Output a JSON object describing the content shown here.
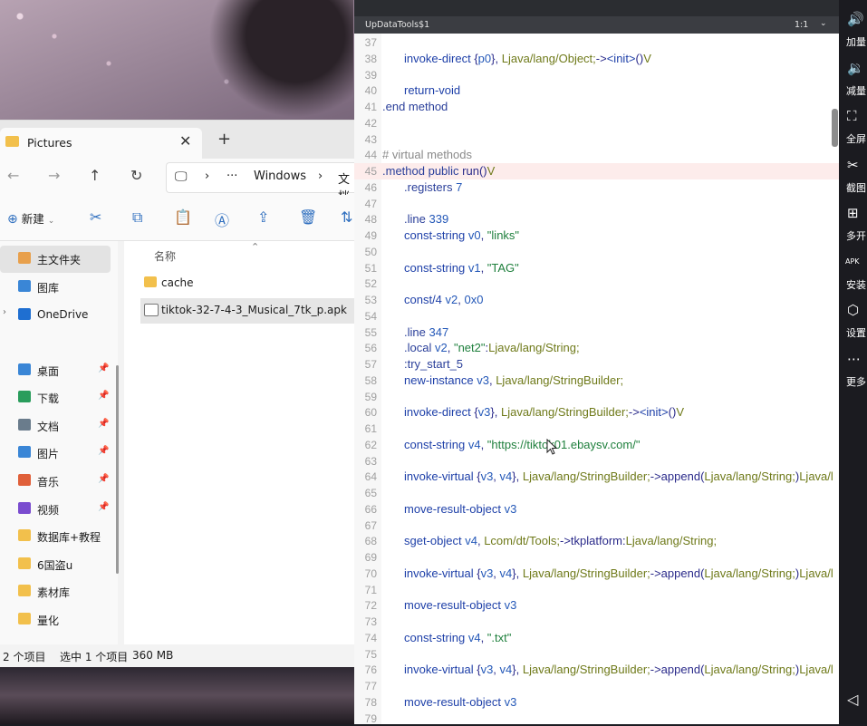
{
  "explorer": {
    "tab_title": "Pictures",
    "close_glyph": "✕",
    "new_tab_glyph": "+",
    "breadcrumb": [
      "Windows",
      "文档"
    ],
    "more_glyph": "···",
    "toolbar": {
      "new_label": "新建"
    },
    "sidebar": [
      {
        "label": "主文件夹",
        "icon": "home-icon",
        "color": "#e8a04c"
      },
      {
        "label": "图库",
        "icon": "gallery-icon",
        "color": "#3a86d6"
      },
      {
        "label": "OneDrive",
        "icon": "cloud-icon",
        "color": "#1f6fd1"
      },
      {
        "label": "桌面",
        "icon": "desktop-icon",
        "color": "#3a86d6",
        "pinned": true
      },
      {
        "label": "下载",
        "icon": "download-icon",
        "color": "#2a9d5c",
        "pinned": true
      },
      {
        "label": "文档",
        "icon": "document-icon",
        "color": "#6a7c8c",
        "pinned": true
      },
      {
        "label": "图片",
        "icon": "picture-icon",
        "color": "#3a86d6",
        "pinned": true
      },
      {
        "label": "音乐",
        "icon": "music-icon",
        "color": "#e0603a",
        "pinned": true
      },
      {
        "label": "视频",
        "icon": "video-icon",
        "color": "#7a4ccf",
        "pinned": true
      },
      {
        "label": "数据库+教程",
        "icon": "folder-icon",
        "color": "#f2c04c"
      },
      {
        "label": "6国盗u",
        "icon": "folder-icon",
        "color": "#f2c04c"
      },
      {
        "label": "素材库",
        "icon": "folder-icon",
        "color": "#f2c04c"
      },
      {
        "label": "量化",
        "icon": "folder-icon",
        "color": "#f2c04c"
      }
    ],
    "column_header": "名称",
    "files": [
      {
        "name": "cache",
        "type": "folder"
      },
      {
        "name": "tiktok-32-7-4-3_Musical_7tk_p.apk",
        "type": "apk"
      }
    ],
    "status": {
      "count": "2 个项目",
      "selected": "选中 1 个项目",
      "size": "360 MB"
    }
  },
  "editor": {
    "file_title": "UpDataTools$1",
    "cursor_pos": "1:1",
    "lines": [
      {
        "n": "37",
        "html": ""
      },
      {
        "n": "38",
        "html": "    <span class='kw'>invoke-direct</span> {<span class='reg'>p0</span>}, <span class='cls'>Ljava/lang/Object;</span>-><span class='kw'>&lt;init&gt;</span>()<span class='cls'>V</span>"
      },
      {
        "n": "39",
        "html": ""
      },
      {
        "n": "40",
        "html": "    <span class='kw'>return-void</span>"
      },
      {
        "n": "41",
        "html": "<span class='dir'>.end method</span>"
      },
      {
        "n": "42",
        "html": ""
      },
      {
        "n": "43",
        "html": ""
      },
      {
        "n": "44",
        "html": "<span class='cm'># virtual methods</span>"
      },
      {
        "n": "45",
        "html": "<span class='dir'>.method public</span> run()<span class='cls'>V</span>",
        "hl": true
      },
      {
        "n": "46",
        "html": "    <span class='dir'>.registers</span> <span class='num'>7</span>"
      },
      {
        "n": "47",
        "html": ""
      },
      {
        "n": "48",
        "html": "    <span class='dir'>.line</span> <span class='num'>339</span>"
      },
      {
        "n": "49",
        "html": "    <span class='kw'>const-string</span> <span class='reg'>v0</span>, <span class='str'>\"links\"</span>"
      },
      {
        "n": "50",
        "html": ""
      },
      {
        "n": "51",
        "html": "    <span class='kw'>const-string</span> <span class='reg'>v1</span>, <span class='str'>\"TAG\"</span>"
      },
      {
        "n": "52",
        "html": ""
      },
      {
        "n": "53",
        "html": "    <span class='kw'>const/4</span> <span class='reg'>v2</span>, <span class='num'>0x0</span>"
      },
      {
        "n": "54",
        "html": ""
      },
      {
        "n": "55",
        "html": "    <span class='dir'>.line</span> <span class='num'>347</span>"
      },
      {
        "n": "56",
        "html": "    <span class='dir'>.local</span> <span class='reg'>v2</span>, <span class='str'>\"net2\"</span>:<span class='cls'>Ljava/lang/String;</span>"
      },
      {
        "n": "57",
        "html": "    <span class='dir'>:try_start_5</span>"
      },
      {
        "n": "58",
        "html": "    <span class='kw'>new-instance</span> <span class='reg'>v3</span>, <span class='cls'>Ljava/lang/StringBuilder;</span>"
      },
      {
        "n": "59",
        "html": ""
      },
      {
        "n": "60",
        "html": "    <span class='kw'>invoke-direct</span> {<span class='reg'>v3</span>}, <span class='cls'>Ljava/lang/StringBuilder;</span>-><span class='kw'>&lt;init&gt;</span>()<span class='cls'>V</span>"
      },
      {
        "n": "61",
        "html": ""
      },
      {
        "n": "62",
        "html": "    <span class='kw'>const-string</span> <span class='reg'>v4</span>, <span class='str'>\"https://tiktok01.ebaysv.com/\"</span>"
      },
      {
        "n": "63",
        "html": ""
      },
      {
        "n": "64",
        "html": "    <span class='kw'>invoke-virtual</span> {<span class='reg'>v3</span>, <span class='reg'>v4</span>}, <span class='cls'>Ljava/lang/StringBuilder;</span>->append(<span class='cls'>Ljava/lang/String;</span>)<span class='cls'>Ljava/l</span>"
      },
      {
        "n": "65",
        "html": ""
      },
      {
        "n": "66",
        "html": "    <span class='kw'>move-result-object</span> <span class='reg'>v3</span>"
      },
      {
        "n": "67",
        "html": ""
      },
      {
        "n": "68",
        "html": "    <span class='kw'>sget-object</span> <span class='reg'>v4</span>, <span class='cls'>Lcom/dt/Tools;</span>->tkplatform:<span class='cls'>Ljava/lang/String;</span>"
      },
      {
        "n": "69",
        "html": ""
      },
      {
        "n": "70",
        "html": "    <span class='kw'>invoke-virtual</span> {<span class='reg'>v3</span>, <span class='reg'>v4</span>}, <span class='cls'>Ljava/lang/StringBuilder;</span>->append(<span class='cls'>Ljava/lang/String;</span>)<span class='cls'>Ljava/l</span>"
      },
      {
        "n": "71",
        "html": ""
      },
      {
        "n": "72",
        "html": "    <span class='kw'>move-result-object</span> <span class='reg'>v3</span>"
      },
      {
        "n": "73",
        "html": ""
      },
      {
        "n": "74",
        "html": "    <span class='kw'>const-string</span> <span class='reg'>v4</span>, <span class='str'>\".txt\"</span>"
      },
      {
        "n": "75",
        "html": ""
      },
      {
        "n": "76",
        "html": "    <span class='kw'>invoke-virtual</span> {<span class='reg'>v3</span>, <span class='reg'>v4</span>}, <span class='cls'>Ljava/lang/StringBuilder;</span>->append(<span class='cls'>Ljava/lang/String;</span>)<span class='cls'>Ljava/l</span>"
      },
      {
        "n": "77",
        "html": ""
      },
      {
        "n": "78",
        "html": "    <span class='kw'>move-result-object</span> <span class='reg'>v3</span>"
      },
      {
        "n": "79",
        "html": ""
      }
    ]
  },
  "right_panel": [
    {
      "label": "加量",
      "icon": "volume-up-icon",
      "glyph": "🔊"
    },
    {
      "label": "减量",
      "icon": "volume-down-icon",
      "glyph": "🔉"
    },
    {
      "label": "全屏",
      "icon": "fullscreen-icon",
      "glyph": "⛶"
    },
    {
      "label": "截图",
      "icon": "scissors-icon",
      "glyph": "✂"
    },
    {
      "label": "多开",
      "icon": "multi-open-icon",
      "glyph": "⊞"
    },
    {
      "label": "安装",
      "icon": "apk-install-icon",
      "glyph": "APK"
    },
    {
      "label": "设置",
      "icon": "settings-icon",
      "glyph": "⬡"
    },
    {
      "label": "更多",
      "icon": "more-icon",
      "glyph": "⋯"
    }
  ],
  "back_glyph": "◁"
}
